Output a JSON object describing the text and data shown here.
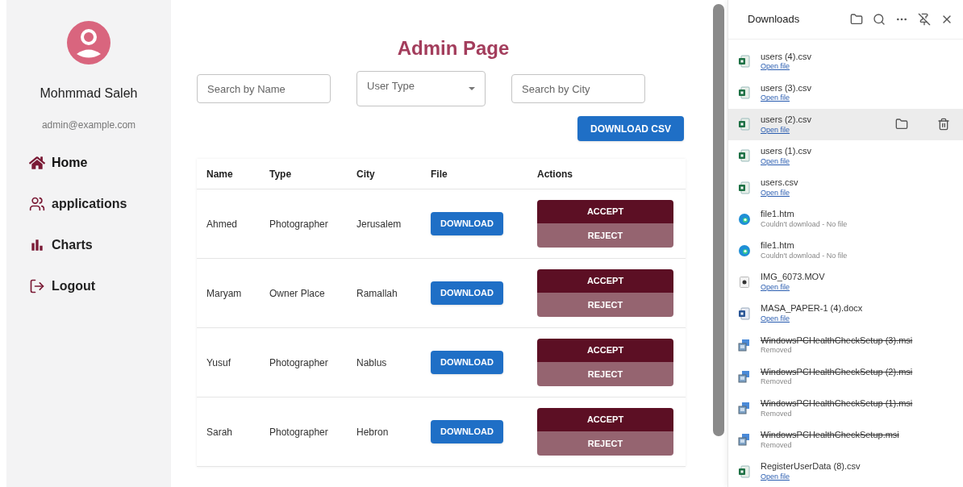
{
  "sidebar": {
    "user_name": "Mohmmad Saleh",
    "email": "admin@example.com",
    "items": [
      {
        "label": "Home",
        "selected": true
      },
      {
        "label": "applications",
        "selected": false
      },
      {
        "label": "Charts",
        "selected": false
      },
      {
        "label": "Logout",
        "selected": false
      }
    ]
  },
  "main": {
    "title": "Admin Page",
    "filters": {
      "name": {
        "placeholder": "Search by Name"
      },
      "user_type": {
        "placeholder": "User Type"
      },
      "city": {
        "placeholder": "Search by City"
      }
    },
    "download_csv": "DOWNLOAD CSV",
    "table": {
      "columns": [
        "Name",
        "Type",
        "City",
        "File",
        "Actions"
      ],
      "rows": [
        {
          "name": "Ahmed",
          "type": "Photographer",
          "city": "Jerusalem",
          "file": "DOWNLOAD",
          "accept": "ACCEPT",
          "reject": "REJECT"
        },
        {
          "name": "Maryam",
          "type": "Owner Place",
          "city": "Ramallah",
          "file": "DOWNLOAD",
          "accept": "ACCEPT",
          "reject": "REJECT"
        },
        {
          "name": "Yusuf",
          "type": "Photographer",
          "city": "Nablus",
          "file": "DOWNLOAD",
          "accept": "ACCEPT",
          "reject": "REJECT"
        },
        {
          "name": "Sarah",
          "type": "Photographer",
          "city": "Hebron",
          "file": "DOWNLOAD",
          "accept": "ACCEPT",
          "reject": "REJECT"
        }
      ]
    }
  },
  "downloads": {
    "title": "Downloads",
    "items": [
      {
        "name": "users (4).csv",
        "kind": "csv",
        "status": {
          "kind": "link",
          "text": "Open file"
        },
        "selected": false
      },
      {
        "name": "users (3).csv",
        "kind": "csv",
        "status": {
          "kind": "link",
          "text": "Open file"
        },
        "selected": false
      },
      {
        "name": "users (2).csv",
        "kind": "csv",
        "status": {
          "kind": "link",
          "text": "Open file"
        },
        "selected": true
      },
      {
        "name": "users (1).csv",
        "kind": "csv",
        "status": {
          "kind": "link",
          "text": "Open file"
        },
        "selected": false
      },
      {
        "name": "users.csv",
        "kind": "csv",
        "status": {
          "kind": "link",
          "text": "Open file"
        },
        "selected": false
      },
      {
        "name": "file1.htm",
        "kind": "web",
        "status": {
          "kind": "error",
          "text": "Couldn't download - No file"
        },
        "selected": false
      },
      {
        "name": "file1.htm",
        "kind": "web",
        "status": {
          "kind": "error",
          "text": "Couldn't download - No file"
        },
        "selected": false
      },
      {
        "name": "IMG_6073.MOV",
        "kind": "video",
        "status": {
          "kind": "link",
          "text": "Open file"
        },
        "selected": false
      },
      {
        "name": "MASA_PAPER-1 (4).docx",
        "kind": "doc",
        "status": {
          "kind": "link",
          "text": "Open file"
        },
        "selected": false
      },
      {
        "name": "WindowsPCHealthCheckSetup (3).msi",
        "kind": "installer",
        "status": {
          "kind": "removed",
          "text": "Removed"
        },
        "selected": false
      },
      {
        "name": "WindowsPCHealthCheckSetup (2).msi",
        "kind": "installer",
        "status": {
          "kind": "removed",
          "text": "Removed"
        },
        "selected": false
      },
      {
        "name": "WindowsPCHealthCheckSetup (1).msi",
        "kind": "installer",
        "status": {
          "kind": "removed",
          "text": "Removed"
        },
        "selected": false
      },
      {
        "name": "WindowsPCHealthCheckSetup.msi",
        "kind": "installer",
        "status": {
          "kind": "removed",
          "text": "Removed"
        },
        "selected": false
      },
      {
        "name": "RegisterUserData (8).csv",
        "kind": "csv",
        "status": {
          "kind": "link",
          "text": "Open file"
        },
        "selected": false
      }
    ]
  }
}
